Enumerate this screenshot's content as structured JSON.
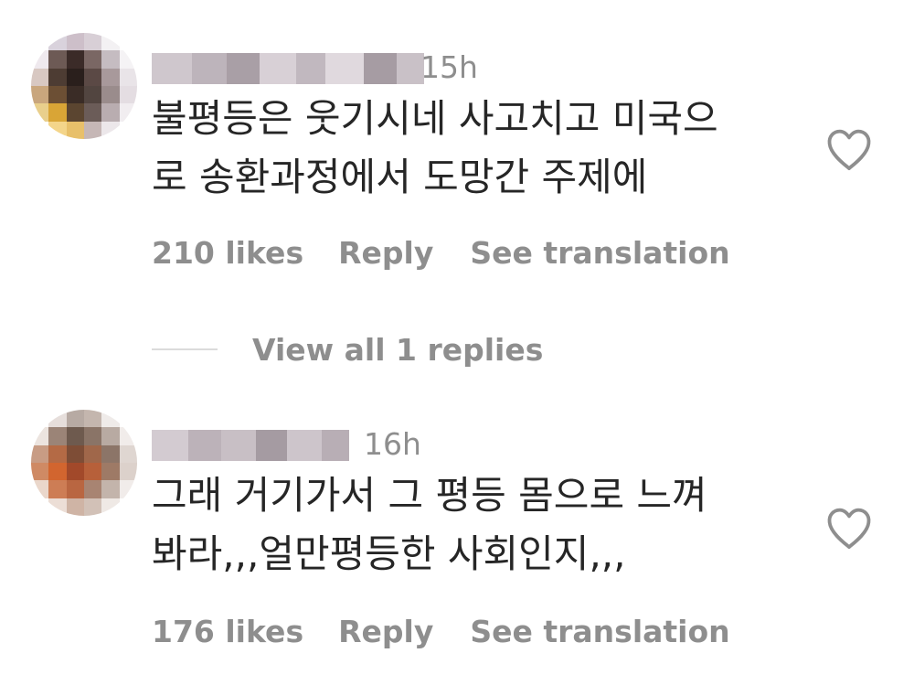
{
  "comments": [
    {
      "time": "15h",
      "text_lines": [
        "불평등은 웃기시네 사고치고 미국으",
        "로 송환과정에서 도망간 주제에"
      ],
      "likes": "210 likes",
      "reply_label": "Reply",
      "translate_label": "See translation"
    },
    {
      "time": "16h",
      "text_lines": [
        "그래 거기가서 그 평등 몸으로 느껴",
        "봐라,,,얼만평등한 사회인지,,,"
      ],
      "likes": "176 likes",
      "reply_label": "Reply",
      "translate_label": "See translation"
    }
  ],
  "view_replies_label": "View all 1 replies",
  "icons": {
    "like": "heart-outline-icon",
    "avatar": "pixelated-avatar"
  },
  "colors": {
    "text": "#262626",
    "muted": "#8e8e8e",
    "divider": "#dbdbdb"
  }
}
